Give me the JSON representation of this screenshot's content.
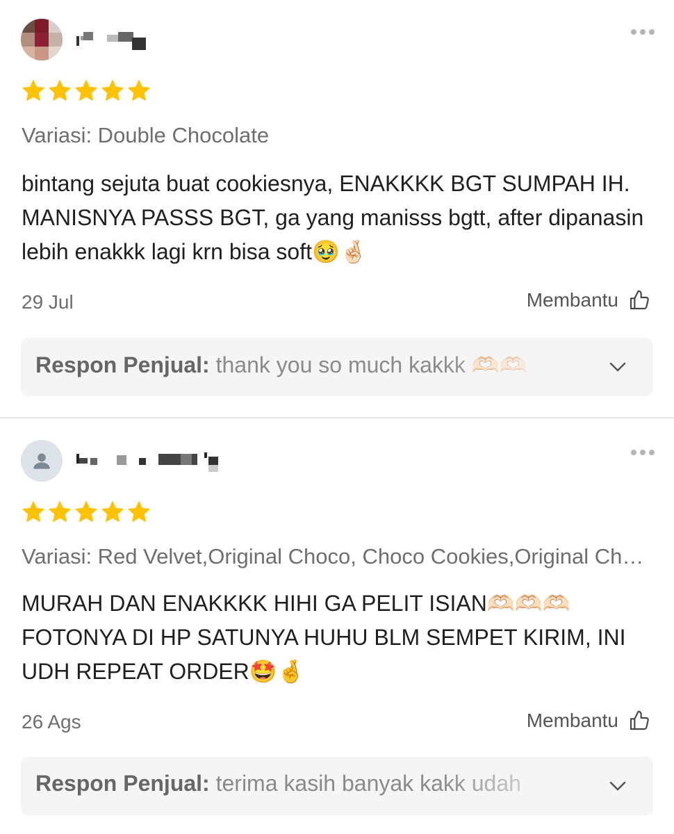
{
  "reviews": [
    {
      "stars": 5,
      "variant": "Variasi: Double Chocolate",
      "comment": "bintang sejuta buat cookiesnya, ENAKKKK BGT SUMPAH IH. MANISNYA PASSS BGT, ga yang manisss bgtt, after dipanasin lebih enakkk lagi krn bisa soft🥹🤞🏻",
      "date": "29 Jul",
      "helpful_label": "Membantu",
      "seller_label": "Respon Penjual:",
      "seller_text": "thank you so much kakkk 🫶🏻🫶🏻"
    },
    {
      "stars": 5,
      "variant": "Variasi: Red Velvet,Original Choco, Choco Cookies,Original Choco, Double Chocolate",
      "comment": "MURAH DAN ENAKKKK HIHI GA PELIT ISIAN🫶🏻🫶🏻🫶🏻 FOTONYA DI HP SATUNYA HUHU BLM SEMPET KIRIM, INI UDH REPEAT ORDER🤩🤞",
      "date": "26 Ags",
      "helpful_label": "Membantu",
      "seller_label": "Respon Penjual:",
      "seller_text": "terima kasih banyak kakk udah"
    }
  ],
  "colors": {
    "star": "#FFC200",
    "muted_text": "#6e6e6e",
    "response_bg": "#f5f5f5",
    "divider": "#e6e6e6"
  },
  "icons": {
    "more": "more-horizontal-icon",
    "helpful": "thumbs-up-icon",
    "expand": "chevron-down-icon",
    "default_avatar": "user-icon"
  }
}
